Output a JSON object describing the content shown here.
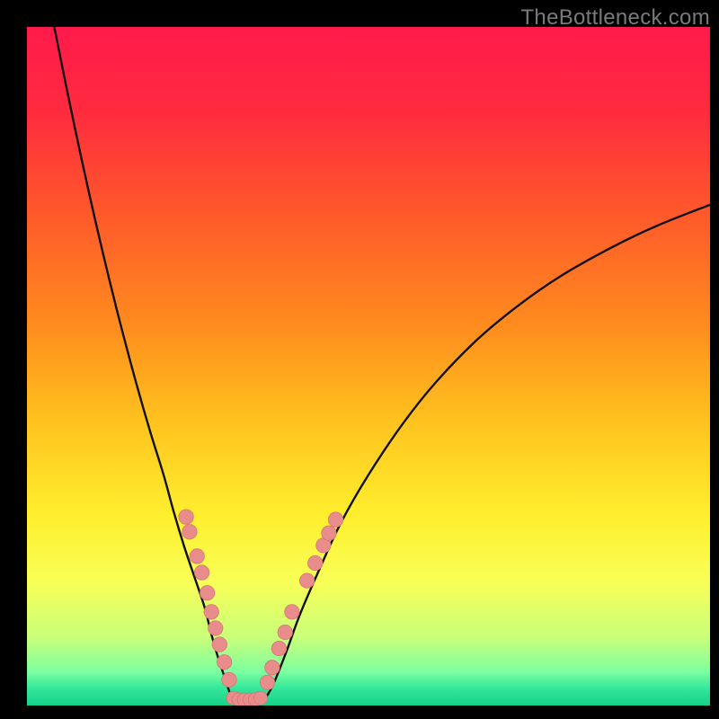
{
  "watermark": "TheBottleneck.com",
  "colors": {
    "gradient_stops": [
      {
        "offset": 0.0,
        "color": "#ff1a4b"
      },
      {
        "offset": 0.12,
        "color": "#ff2a3f"
      },
      {
        "offset": 0.28,
        "color": "#ff5a2a"
      },
      {
        "offset": 0.44,
        "color": "#ff8c1e"
      },
      {
        "offset": 0.58,
        "color": "#ffc21e"
      },
      {
        "offset": 0.72,
        "color": "#ffef2e"
      },
      {
        "offset": 0.82,
        "color": "#f7ff58"
      },
      {
        "offset": 0.9,
        "color": "#c9ff7a"
      },
      {
        "offset": 0.95,
        "color": "#7dffa0"
      },
      {
        "offset": 0.975,
        "color": "#33e79a"
      },
      {
        "offset": 1.0,
        "color": "#16d08a"
      }
    ],
    "curve": "#111111",
    "dot_fill": "#e98c8c",
    "dot_stroke": "#d87575",
    "black": "#000000"
  },
  "chart_data": {
    "type": "line",
    "title": "",
    "xlabel": "",
    "ylabel": "",
    "xlim": [
      0,
      100
    ],
    "ylim": [
      0,
      100
    ],
    "grid": false,
    "legend": false,
    "series": [
      {
        "name": "left_branch",
        "x": [
          4,
          6,
          8,
          10,
          12,
          14,
          16,
          18,
          20,
          21.5,
          23,
          24.5,
          26,
          27,
          28,
          29,
          29.8,
          30.5
        ],
        "y": [
          100,
          90,
          80.5,
          71.5,
          63,
          55,
          47.5,
          40.5,
          34,
          28.5,
          23.5,
          19,
          14.5,
          10.5,
          7,
          4,
          1.6,
          0.6
        ]
      },
      {
        "name": "valley",
        "x": [
          30.5,
          31.5,
          32.5,
          33.5,
          34.5
        ],
        "y": [
          0.6,
          0.25,
          0.2,
          0.25,
          0.6
        ]
      },
      {
        "name": "right_branch",
        "x": [
          34.5,
          36,
          38,
          40,
          43,
          46,
          50,
          55,
          60,
          66,
          72,
          78,
          85,
          92,
          100
        ],
        "y": [
          0.6,
          3,
          8,
          13.5,
          20.5,
          27,
          34,
          41.5,
          47.8,
          54,
          59,
          63.2,
          67.2,
          70.6,
          73.8
        ]
      }
    ],
    "dots_left": [
      {
        "x": 23.3,
        "y": 27.8
      },
      {
        "x": 23.8,
        "y": 25.6
      },
      {
        "x": 24.9,
        "y": 22.0
      },
      {
        "x": 25.6,
        "y": 19.6
      },
      {
        "x": 26.4,
        "y": 16.6
      },
      {
        "x": 27.0,
        "y": 13.8
      },
      {
        "x": 27.6,
        "y": 11.4
      },
      {
        "x": 28.2,
        "y": 9.0
      },
      {
        "x": 28.9,
        "y": 6.4
      },
      {
        "x": 29.6,
        "y": 3.8
      }
    ],
    "dots_right": [
      {
        "x": 35.2,
        "y": 3.4
      },
      {
        "x": 35.9,
        "y": 5.6
      },
      {
        "x": 36.9,
        "y": 8.4
      },
      {
        "x": 37.8,
        "y": 10.8
      },
      {
        "x": 38.8,
        "y": 13.8
      },
      {
        "x": 41.0,
        "y": 18.4
      },
      {
        "x": 42.2,
        "y": 21.0
      },
      {
        "x": 43.4,
        "y": 23.6
      },
      {
        "x": 44.2,
        "y": 25.4
      },
      {
        "x": 45.2,
        "y": 27.4
      }
    ],
    "dots_bottom": [
      {
        "x": 30.2,
        "y": 1.1
      },
      {
        "x": 31.0,
        "y": 0.9
      },
      {
        "x": 31.8,
        "y": 0.85
      },
      {
        "x": 32.6,
        "y": 0.85
      },
      {
        "x": 33.4,
        "y": 0.9
      },
      {
        "x": 34.2,
        "y": 1.1
      }
    ]
  }
}
